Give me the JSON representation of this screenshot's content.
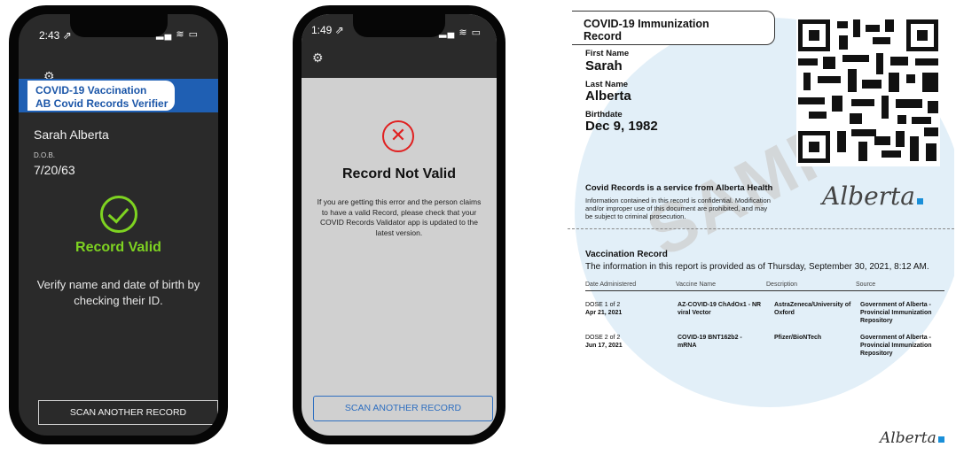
{
  "phone1": {
    "time": "2:43 ⇗",
    "status_icons": "▂▄ ≋ ▭",
    "banner_line1": "COVID-19 Vaccination",
    "banner_line2": "AB Covid Records Verifier",
    "name": "Sarah Alberta",
    "dob_label": "D.O.B.",
    "dob": "7/20/63",
    "result": "Record Valid",
    "instruction": "Verify name and date of birth by checking their ID.",
    "scan_button": "SCAN ANOTHER RECORD",
    "accent": "#7ed321"
  },
  "phone2": {
    "time": "1:49 ⇗",
    "status_icons": "▂▄ ≋ ▭",
    "result": "Record Not Valid",
    "message": "If you are getting this error and the person claims to have a valid Record, please check that your COVID Records Validator app is updated to the latest version.",
    "scan_button": "SCAN ANOTHER RECORD",
    "error_color": "#e02020"
  },
  "record": {
    "title_line1": "COVID-19 Immunization",
    "title_line2": "Record",
    "first_name_label": "First Name",
    "first_name": "Sarah",
    "last_name_label": "Last Name",
    "last_name": "Alberta",
    "birthdate_label": "Birthdate",
    "birthdate": "Dec 9, 1982",
    "watermark": "SAMPLE",
    "service_line": "Covid Records is a service from Alberta Health",
    "confidential_note": "Information contained in this record is confidential. Modification and/or improper use of this document are prohibited, and may be subject to criminal prosecution.",
    "logo_text": "Alberta",
    "vaccination_title": "Vaccination Record",
    "as_of": "The information in this report is provided as of Thursday, September 30, 2021, 8:12 AM.",
    "columns": [
      "Date Administered",
      "Vaccine Name",
      "Description",
      "Source"
    ],
    "rows": [
      {
        "dose": "DOSE 1 of 2",
        "date": "Apr 21, 2021",
        "vaccine": "AZ-COVID-19 ChAdOx1 - NR viral Vector",
        "description": "AstraZeneca/University of Oxford",
        "source": "Government of Alberta - Provincial Immunization Repository"
      },
      {
        "dose": "DOSE 2 of 2",
        "date": "Jun 17, 2021",
        "vaccine": "COVID-19 BNT162b2 - mRNA",
        "description": "Pfizer/BioNTech",
        "source": "Government of Alberta - Provincial Immunization Repository"
      }
    ],
    "footer_logo": "Alberta",
    "brand_blue": "#1a8fd8"
  }
}
